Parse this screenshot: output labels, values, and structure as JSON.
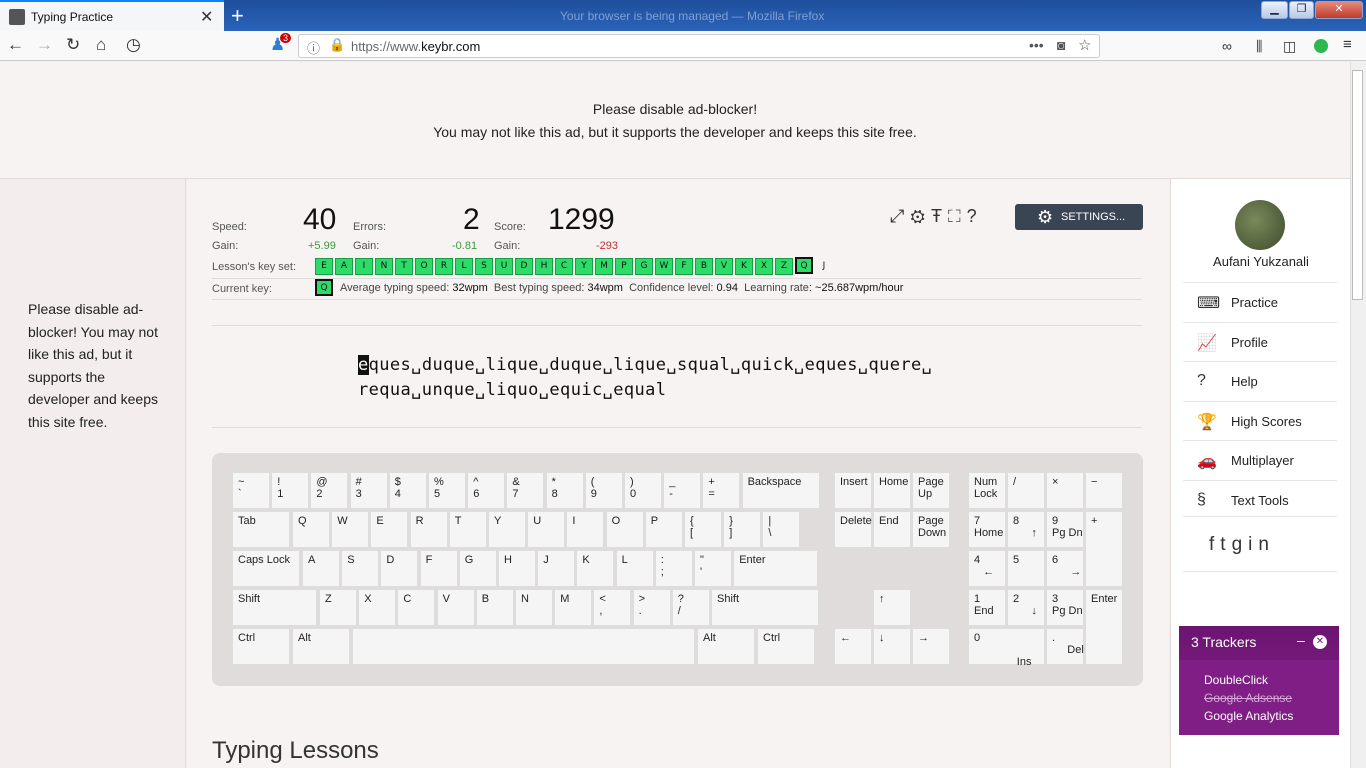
{
  "browser": {
    "tab_title": "Typing Practice",
    "window_title": "Your browser is being managed — Mozilla Firefox",
    "url_prefix": "https://www.",
    "url_domain": "keybr.com",
    "badge_count": "3"
  },
  "ad": {
    "line1": "Please disable ad-blocker!",
    "line2": "You may not like this ad, but it supports the developer and keeps this site free.",
    "side_text": "Please disable ad-blocker! You may not like this ad, but it supports the developer and keeps this site free."
  },
  "stats": {
    "speed_label": "Speed:",
    "speed": "40",
    "speed_gain_label": "Gain:",
    "speed_gain": "+5.99",
    "errors_label": "Errors:",
    "errors": "2",
    "errors_gain_label": "Gain:",
    "errors_gain": "-0.81",
    "score_label": "Score:",
    "score": "1299",
    "score_gain_label": "Gain:",
    "score_gain": "-293",
    "keyset_label": "Lesson's key set:",
    "keys": [
      "E",
      "A",
      "I",
      "N",
      "T",
      "O",
      "R",
      "L",
      "S",
      "U",
      "D",
      "H",
      "C",
      "Y",
      "M",
      "P",
      "G",
      "W",
      "F",
      "B",
      "V",
      "K",
      "X",
      "Z",
      "Q",
      "J"
    ],
    "current_key_label": "Current key:",
    "current_key": "Q",
    "avg_label": "Average typing speed:",
    "avg": "32wpm",
    "best_label": "Best typing speed:",
    "best": "34wpm",
    "conf_label": "Confidence level:",
    "conf": "0.94",
    "rate_label": "Learning rate:",
    "rate": "~25.687wpm/hour"
  },
  "settings_label": "SETTINGS...",
  "typing": {
    "cursor_char": "e",
    "line1_rest": "ques␣duque␣lique␣duque␣lique␣squal␣quick␣eques␣quere␣",
    "line2": "requa␣unque␣liquo␣equic␣equal"
  },
  "keyboard": {
    "row1": [
      "~\n`",
      "!\n1",
      "@\n2",
      "#\n3",
      "$\n4",
      "%\n5",
      "^\n6",
      "&\n7",
      "*\n8",
      "(\n9",
      ")\n0",
      "_\n-",
      "+\n="
    ],
    "backspace": "Backspace",
    "tab": "Tab",
    "row2": [
      "Q",
      "W",
      "E",
      "R",
      "T",
      "Y",
      "U",
      "I",
      "O",
      "P",
      "{\n[",
      "}\n]",
      "|\n\\"
    ],
    "caps": "Caps Lock",
    "row3": [
      "A",
      "S",
      "D",
      "F",
      "G",
      "H",
      "J",
      "K",
      "L",
      ":\n;",
      "\"\n'"
    ],
    "enter": "Enter",
    "shift": "Shift",
    "row4": [
      "Z",
      "X",
      "C",
      "V",
      "B",
      "N",
      "M",
      "<\n,",
      ">\n.",
      "?\n/"
    ],
    "ctrl": "Ctrl",
    "alt": "Alt",
    "nav": [
      "Insert",
      "Home",
      "Page\nUp",
      "Delete",
      "End",
      "Page\nDown"
    ],
    "arrows": [
      "↑",
      "←",
      "↓",
      "→"
    ],
    "numpad": [
      "Num\nLock",
      "/",
      "×",
      "−",
      "7\nHome",
      "8\n      ↑",
      "9\nPg Dn",
      "+",
      "4\n   ←",
      "5",
      "6\n      →",
      "1\nEnd",
      "2\n      ↓",
      "3\nPg Dn",
      "Enter",
      "0\n\n              Ins",
      ".\n     Del"
    ]
  },
  "lessons_heading": "Typing Lessons",
  "sidebar": {
    "username": "Aufani Yukzanali",
    "items": [
      {
        "label": "Practice",
        "icon": "⌨"
      },
      {
        "label": "Profile",
        "icon": "📈"
      },
      {
        "label": "Help",
        "icon": "?"
      },
      {
        "label": "High Scores",
        "icon": "🏆"
      },
      {
        "label": "Multiplayer",
        "icon": "🚗"
      },
      {
        "label": "Text Tools",
        "icon": "§"
      }
    ]
  },
  "trackers": {
    "title": "3 Trackers",
    "items": [
      "DoubleClick",
      "Google Adsense",
      "Google Analytics"
    ]
  }
}
